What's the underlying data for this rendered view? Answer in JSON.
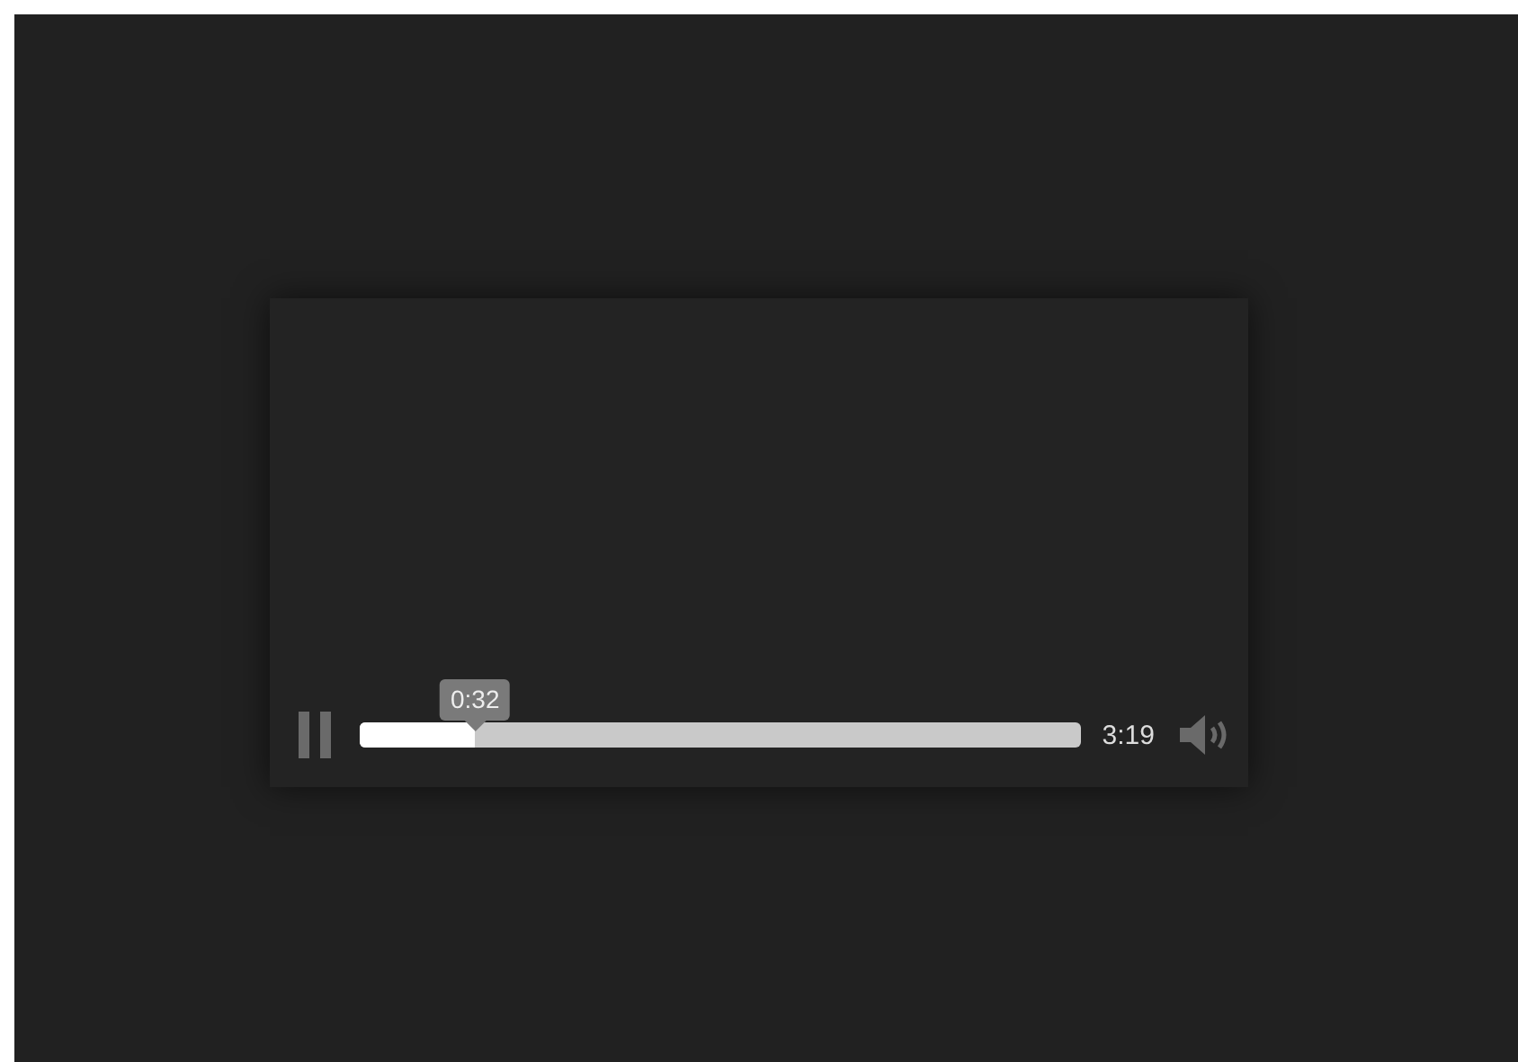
{
  "player": {
    "playing": true,
    "progress": {
      "level": 0.16,
      "tooltip": "0:32"
    },
    "duration": "3:19",
    "muted": false
  }
}
